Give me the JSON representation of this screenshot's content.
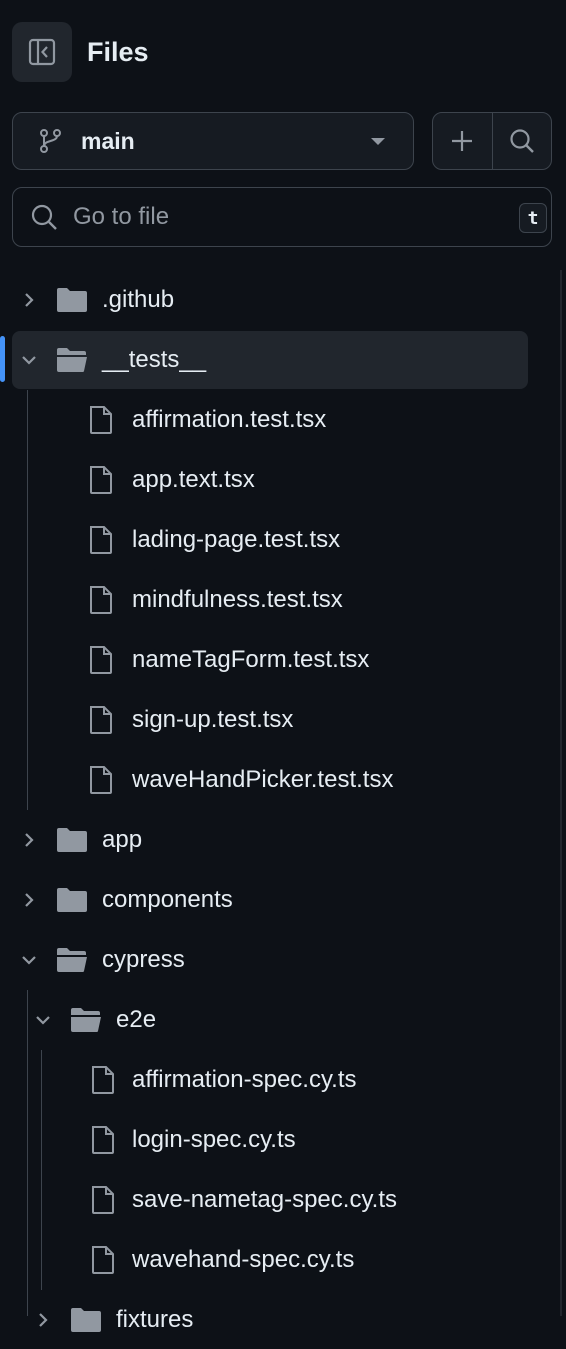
{
  "header": {
    "title": "Files"
  },
  "branch": {
    "name": "main"
  },
  "search": {
    "placeholder": "Go to file",
    "shortcut": "t"
  },
  "colors": {
    "accent": "#4493f8",
    "folder": "#9198a1",
    "background": "#0d1117"
  },
  "tree": [
    {
      "name": ".github",
      "type": "folder",
      "expanded": false,
      "depth": 0
    },
    {
      "name": "__tests__",
      "type": "folder",
      "expanded": true,
      "depth": 0,
      "selected": true
    },
    {
      "name": "affirmation.test.tsx",
      "type": "file",
      "depth": 1
    },
    {
      "name": "app.text.tsx",
      "type": "file",
      "depth": 1
    },
    {
      "name": "lading-page.test.tsx",
      "type": "file",
      "depth": 1
    },
    {
      "name": "mindfulness.test.tsx",
      "type": "file",
      "depth": 1
    },
    {
      "name": "nameTagForm.test.tsx",
      "type": "file",
      "depth": 1
    },
    {
      "name": "sign-up.test.tsx",
      "type": "file",
      "depth": 1
    },
    {
      "name": "waveHandPicker.test.tsx",
      "type": "file",
      "depth": 1
    },
    {
      "name": "app",
      "type": "folder",
      "expanded": false,
      "depth": 0
    },
    {
      "name": "components",
      "type": "folder",
      "expanded": false,
      "depth": 0
    },
    {
      "name": "cypress",
      "type": "folder",
      "expanded": true,
      "depth": 0
    },
    {
      "name": "e2e",
      "type": "folder",
      "expanded": true,
      "depth": 1
    },
    {
      "name": "affirmation-spec.cy.ts",
      "type": "file",
      "depth": 2
    },
    {
      "name": "login-spec.cy.ts",
      "type": "file",
      "depth": 2
    },
    {
      "name": "save-nametag-spec.cy.ts",
      "type": "file",
      "depth": 2
    },
    {
      "name": "wavehand-spec.cy.ts",
      "type": "file",
      "depth": 2
    },
    {
      "name": "fixtures",
      "type": "folder",
      "expanded": false,
      "depth": 1
    }
  ]
}
